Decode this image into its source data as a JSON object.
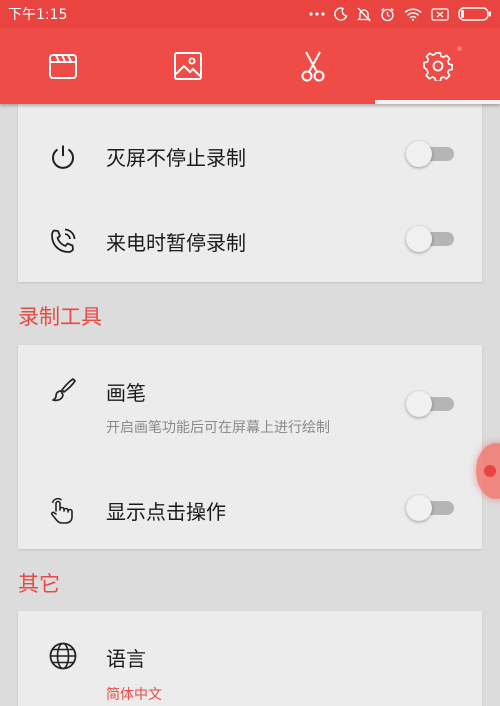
{
  "status_bar": {
    "time": "下午1:15",
    "icons": [
      "more-dots-icon",
      "moon-icon",
      "mute-bell-icon",
      "alarm-icon",
      "wifi-icon",
      "sim-off-icon",
      "battery-icon"
    ]
  },
  "toolbar": {
    "tabs": [
      {
        "icon": "video-clapper-icon"
      },
      {
        "icon": "image-icon"
      },
      {
        "icon": "scissors-icon"
      },
      {
        "icon": "gear-icon",
        "selected": true
      }
    ]
  },
  "settings": {
    "card1": {
      "rows": [
        {
          "icon": "power-icon",
          "title": "灭屏不停止录制",
          "enabled": false
        },
        {
          "icon": "phone-call-icon",
          "title": "来电时暂停录制",
          "enabled": false
        }
      ]
    },
    "section_tools": "录制工具",
    "card2": {
      "rows": [
        {
          "icon": "brush-icon",
          "title": "画笔",
          "subtitle": "开启画笔功能后可在屏幕上进行绘制",
          "enabled": false
        },
        {
          "icon": "hand-tap-icon",
          "title": "显示点击操作",
          "enabled": false
        }
      ]
    },
    "section_other": "其它",
    "card3": {
      "rows": [
        {
          "icon": "globe-icon",
          "title": "语言",
          "subtitle": "简体中文"
        }
      ]
    }
  },
  "colors": {
    "brand": "#ef4b47",
    "accent_text": "#e84a45",
    "background": "#dcdcdc",
    "card": "#ececec"
  }
}
